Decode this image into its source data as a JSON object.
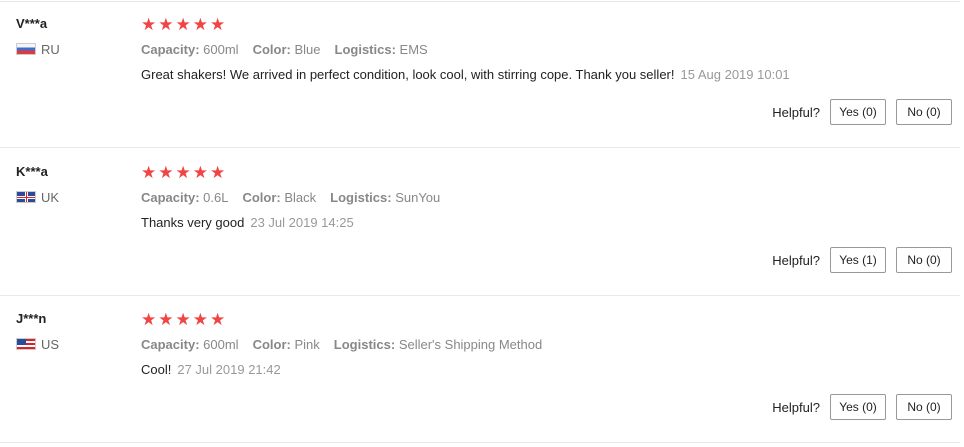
{
  "reviews": [
    {
      "user": "V***a",
      "country": "RU",
      "flag_icon": "russia-flag-icon",
      "rating": 5,
      "capacity_label": "Capacity:",
      "capacity": "600ml",
      "color_label": "Color:",
      "color": "Blue",
      "logistics_label": "Logistics:",
      "logistics": "EMS",
      "comment": "Great shakers! We arrived in perfect condition, look cool, with stirring cope. Thank you seller!",
      "date": "15 Aug 2019 10:01",
      "helpful_label": "Helpful?",
      "yes_label": "Yes (0)",
      "no_label": "No (0)"
    },
    {
      "user": "K***a",
      "country": "UK",
      "flag_icon": "uk-flag-icon",
      "rating": 5,
      "capacity_label": "Capacity:",
      "capacity": "0.6L",
      "color_label": "Color:",
      "color": "Black",
      "logistics_label": "Logistics:",
      "logistics": "SunYou",
      "comment": "Thanks very good",
      "date": "23 Jul 2019 14:25",
      "helpful_label": "Helpful?",
      "yes_label": "Yes (1)",
      "no_label": "No (0)"
    },
    {
      "user": "J***n",
      "country": "US",
      "flag_icon": "us-flag-icon",
      "rating": 5,
      "capacity_label": "Capacity:",
      "capacity": "600ml",
      "color_label": "Color:",
      "color": "Pink",
      "logistics_label": "Logistics:",
      "logistics": "Seller's Shipping Method",
      "comment": "Cool!",
      "date": "27 Jul 2019 21:42",
      "helpful_label": "Helpful?",
      "yes_label": "Yes (0)",
      "no_label": "No (0)"
    }
  ],
  "colors": {
    "star": "#f04545",
    "divider": "#e8e8e8",
    "muted": "#888888"
  }
}
